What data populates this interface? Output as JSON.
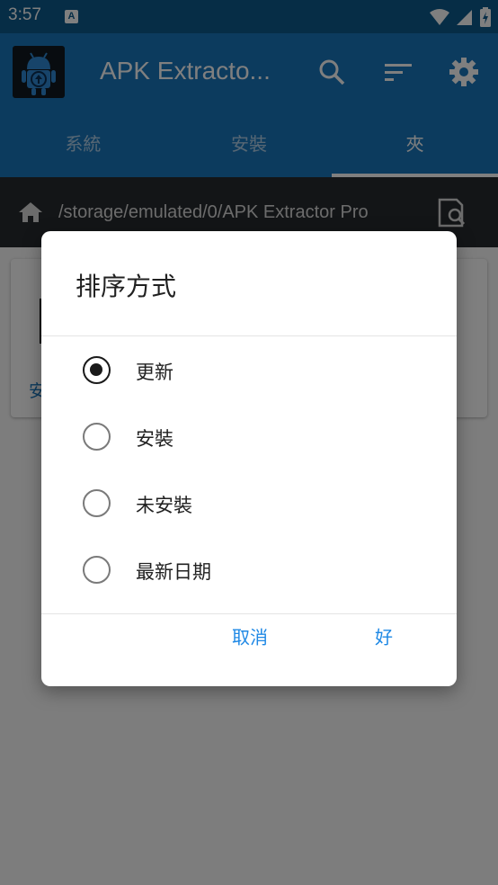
{
  "status_bar": {
    "time": "3:57",
    "notification_icon_letter": "A"
  },
  "app_bar": {
    "title": "APK Extracto..."
  },
  "tabs": [
    {
      "label": "系統",
      "active": false
    },
    {
      "label": "安裝",
      "active": false
    },
    {
      "label": "夾",
      "active": true
    }
  ],
  "path_bar": {
    "path": "/storage/emulated/0/APK Extractor Pro"
  },
  "background_card": {
    "label": "安"
  },
  "dialog": {
    "title": "排序方式",
    "options": [
      {
        "label": "更新",
        "checked": true
      },
      {
        "label": "安裝",
        "checked": false
      },
      {
        "label": "未安裝",
        "checked": false
      },
      {
        "label": "最新日期",
        "checked": false
      }
    ],
    "cancel_label": "取消",
    "ok_label": "好"
  },
  "colors": {
    "status_bar": "#0c5a8c",
    "primary": "#1976bc",
    "path_bar": "#262a2e",
    "accent": "#1e88e5"
  }
}
